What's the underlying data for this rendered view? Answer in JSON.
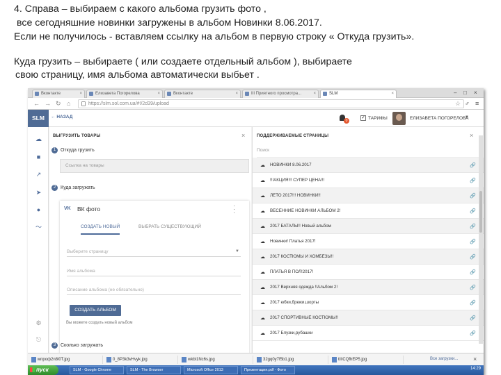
{
  "instructions": {
    "line1": "4. Справа – выбираем с какого альбома грузить фото ,",
    "line2": "все сегодняшние новинки загружены в альбом Новинки 8.06.2017.",
    "line3": "Если не получилось -  вставляем ссылку на альбом в первую строку « Откуда грузить».",
    "line4": "Куда грузить – выбираете ( или создаете отдельный альбом ), выбираете",
    "line5": "свою страницу, имя альбома автоматически  выбьет ."
  },
  "browser": {
    "tabs": [
      "Вконтакте",
      "Елизавета Погорелова",
      "Вконтакте",
      "III Приятного просмотра...",
      "SLM"
    ],
    "window_controls": [
      "–",
      "□",
      "×"
    ],
    "url": "https://slm.sol.com.ua/#!/2d39/upload"
  },
  "app": {
    "logo": "SLM",
    "back_label": "НАЗАД",
    "notification_count": "0",
    "tariffs_label": "ТАРИФЫ",
    "user_name": "ЕЛИЗАВЕТА ПОГОРЕЛОВА",
    "left_panel": {
      "title": "ВЫГРУЗИТЬ ТОВАРЫ",
      "step1_num": "1",
      "step1_label": "Откуда грузить",
      "source_placeholder": "Ссылка на товары",
      "step2_num": "2",
      "step2_label": "Куда загружать",
      "vk_logo": "VK",
      "vk_title": "ВК фото",
      "tab_create": "СОЗДАТЬ НОВЫЙ",
      "tab_choose": "ВЫБРАТЬ СУЩЕСТВУЮЩИЙ",
      "page_select": "Выберите страницу",
      "album_name": "Имя альбома",
      "album_desc": "Описание альбома (не обязательно)",
      "create_button": "СОЗДАТЬ АЛЬБОМ",
      "hint": "Вы можете создать новый альбом",
      "step3_num": "3",
      "step3_label": "Сколько загружать"
    },
    "right_panel": {
      "title": "ПОДДЕРЖИВАЕМЫЕ СТРАНИЦЫ",
      "search_placeholder": "Поиск",
      "albums": [
        "НОВИНКИ 8.06.2017",
        "!!!АКЦИЯ!!! СУПЕР ЦЕНА!!!",
        "ЛЕТО 2017!!! НОВИНКИ!!",
        "ВЕСЕННИЕ НОВИНКИ АЛЬБОМ 2!",
        "2017 БАТАЛЫ!! Новый альбом",
        "Новинки! Платья 2017!",
        "2017 КОСТЮМЫ И ХОМБЕЗЫ!!",
        "ПЛАТЬЯ В ПОЛ!2017!",
        "2017 Верхняя одежда !!Альбом 2!",
        "2017 юбки,брюки,шорты",
        "2017 СПОРТИВНЫЕ КОСТЮМЫ!!",
        "2017 Блузки,рубашки"
      ]
    }
  },
  "downloads": {
    "files": [
      "мпроф2n8l0T.jpg",
      "0_8P3k3vHvyk.jpg",
      "wkbl1Nc6s.jpg",
      "32gq0y7f5b1.jpg",
      "tIlICQfhEP5.jpg"
    ],
    "show_all": "Все загрузки..."
  },
  "taskbar": {
    "start": "пуск",
    "items": [
      "SLM - Google Chrome",
      "SLM - The Browser",
      "Microsoft Office 2013",
      "Презентация.pdf - Фото"
    ],
    "clock": "14:29"
  }
}
